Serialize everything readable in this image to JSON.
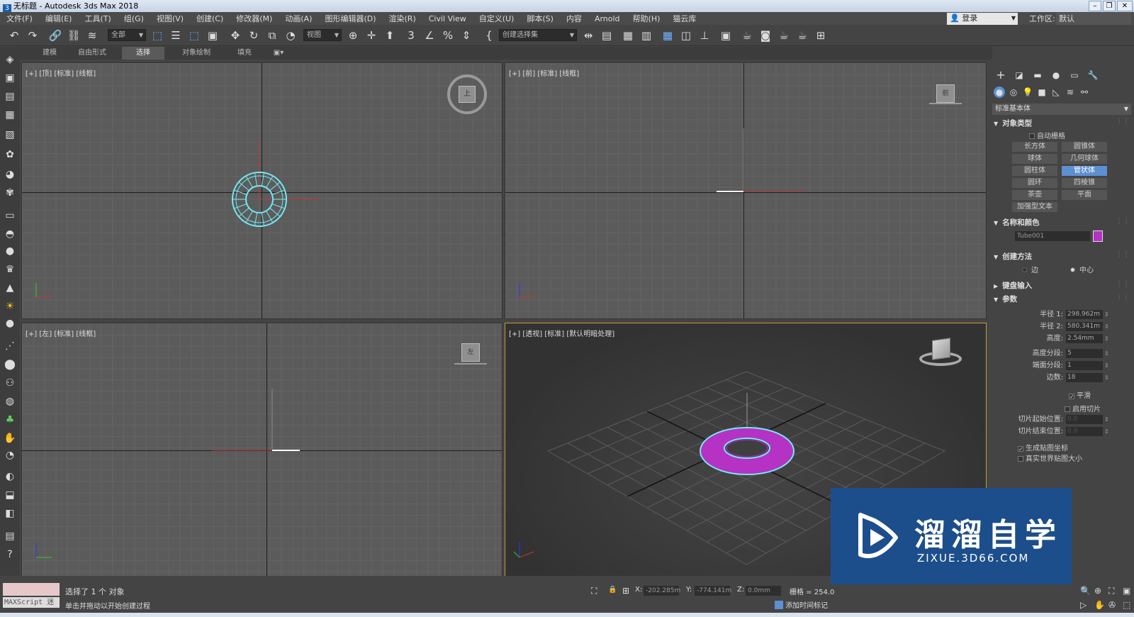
{
  "window": {
    "title": "无标题 - Autodesk 3ds Max 2018"
  },
  "menu": [
    "文件(F)",
    "编辑(E)",
    "工具(T)",
    "组(G)",
    "视图(V)",
    "创建(C)",
    "修改器(M)",
    "动画(A)",
    "图形编辑器(D)",
    "渲染(R)",
    "Civil View",
    "自定义(U)",
    "脚本(S)",
    "内容",
    "Arnold",
    "帮助(H)",
    "猫云库"
  ],
  "header": {
    "login": "登录",
    "workspace_label": "工作区:",
    "workspace_value": "默认"
  },
  "toolbar": {
    "filter": "全部",
    "ref_coord": "视图",
    "named_sel": "创建选择集"
  },
  "ribbon": {
    "tabs": [
      "建模",
      "自由形式",
      "选择",
      "对象绘制",
      "填充"
    ],
    "selected": "选择"
  },
  "viewports": {
    "top": "[+] [顶] [标准] [线框]",
    "front": "[+] [前] [标准] [线框]",
    "left": "[+] [左] [标准] [线框]",
    "persp": "[+] [透视] [标准] [默认明暗处理]",
    "viewcube_top": "上",
    "viewcube_front": "前",
    "viewcube_left": "左"
  },
  "panel": {
    "category": "标准基本体",
    "object_type_title": "对象类型",
    "autogrid": "自动栅格",
    "buttons": [
      "长方体",
      "圆锥体",
      "球体",
      "几何球体",
      "圆柱体",
      "管状体",
      "圆环",
      "四棱锥",
      "茶壶",
      "平面",
      "加强型文本"
    ],
    "active_button": "管状体",
    "name_color_title": "名称和颜色",
    "object_name": "Tube001",
    "object_color": "#b532c4",
    "creation_title": "创建方法",
    "creation_edge": "边",
    "creation_center": "中心",
    "keyboard_title": "键盘输入",
    "params_title": "参数",
    "params": [
      {
        "label": "半径 1:",
        "value": "298.962m"
      },
      {
        "label": "半径 2:",
        "value": "580.341m"
      },
      {
        "label": "高度:",
        "value": "2.54mm"
      },
      {
        "label": "高度分段:",
        "value": "5"
      },
      {
        "label": "端面分段:",
        "value": "1"
      },
      {
        "label": "边数:",
        "value": "18"
      }
    ],
    "smooth": "平滑",
    "slice_on": "启用切片",
    "slice_from_label": "切片起始位置:",
    "slice_from": "0.0",
    "slice_to_label": "切片结束位置:",
    "slice_to": "0.0",
    "gen_map": "生成贴图坐标",
    "real_world": "真实世界贴图大小"
  },
  "status": {
    "line1": "选择了 1 个 对象",
    "line2": "单击并拖动以开始创建过程",
    "maxscript": "MAXScript 迷",
    "x_label": "X:",
    "x": "-202.285m",
    "y_label": "Y:",
    "y": "-774.141m",
    "z_label": "Z:",
    "z": "0.0mm",
    "grid": "栅格 = 254.0",
    "addkey": "添加时间标记"
  },
  "watermark": {
    "title": "溜溜自学",
    "url": "ZIXUE.3D66.COM"
  },
  "colors": {
    "tube": "#b532c4",
    "selection": "#74e8f2",
    "persp_border": "#c59a35",
    "active_button": "#5d8fd3"
  }
}
